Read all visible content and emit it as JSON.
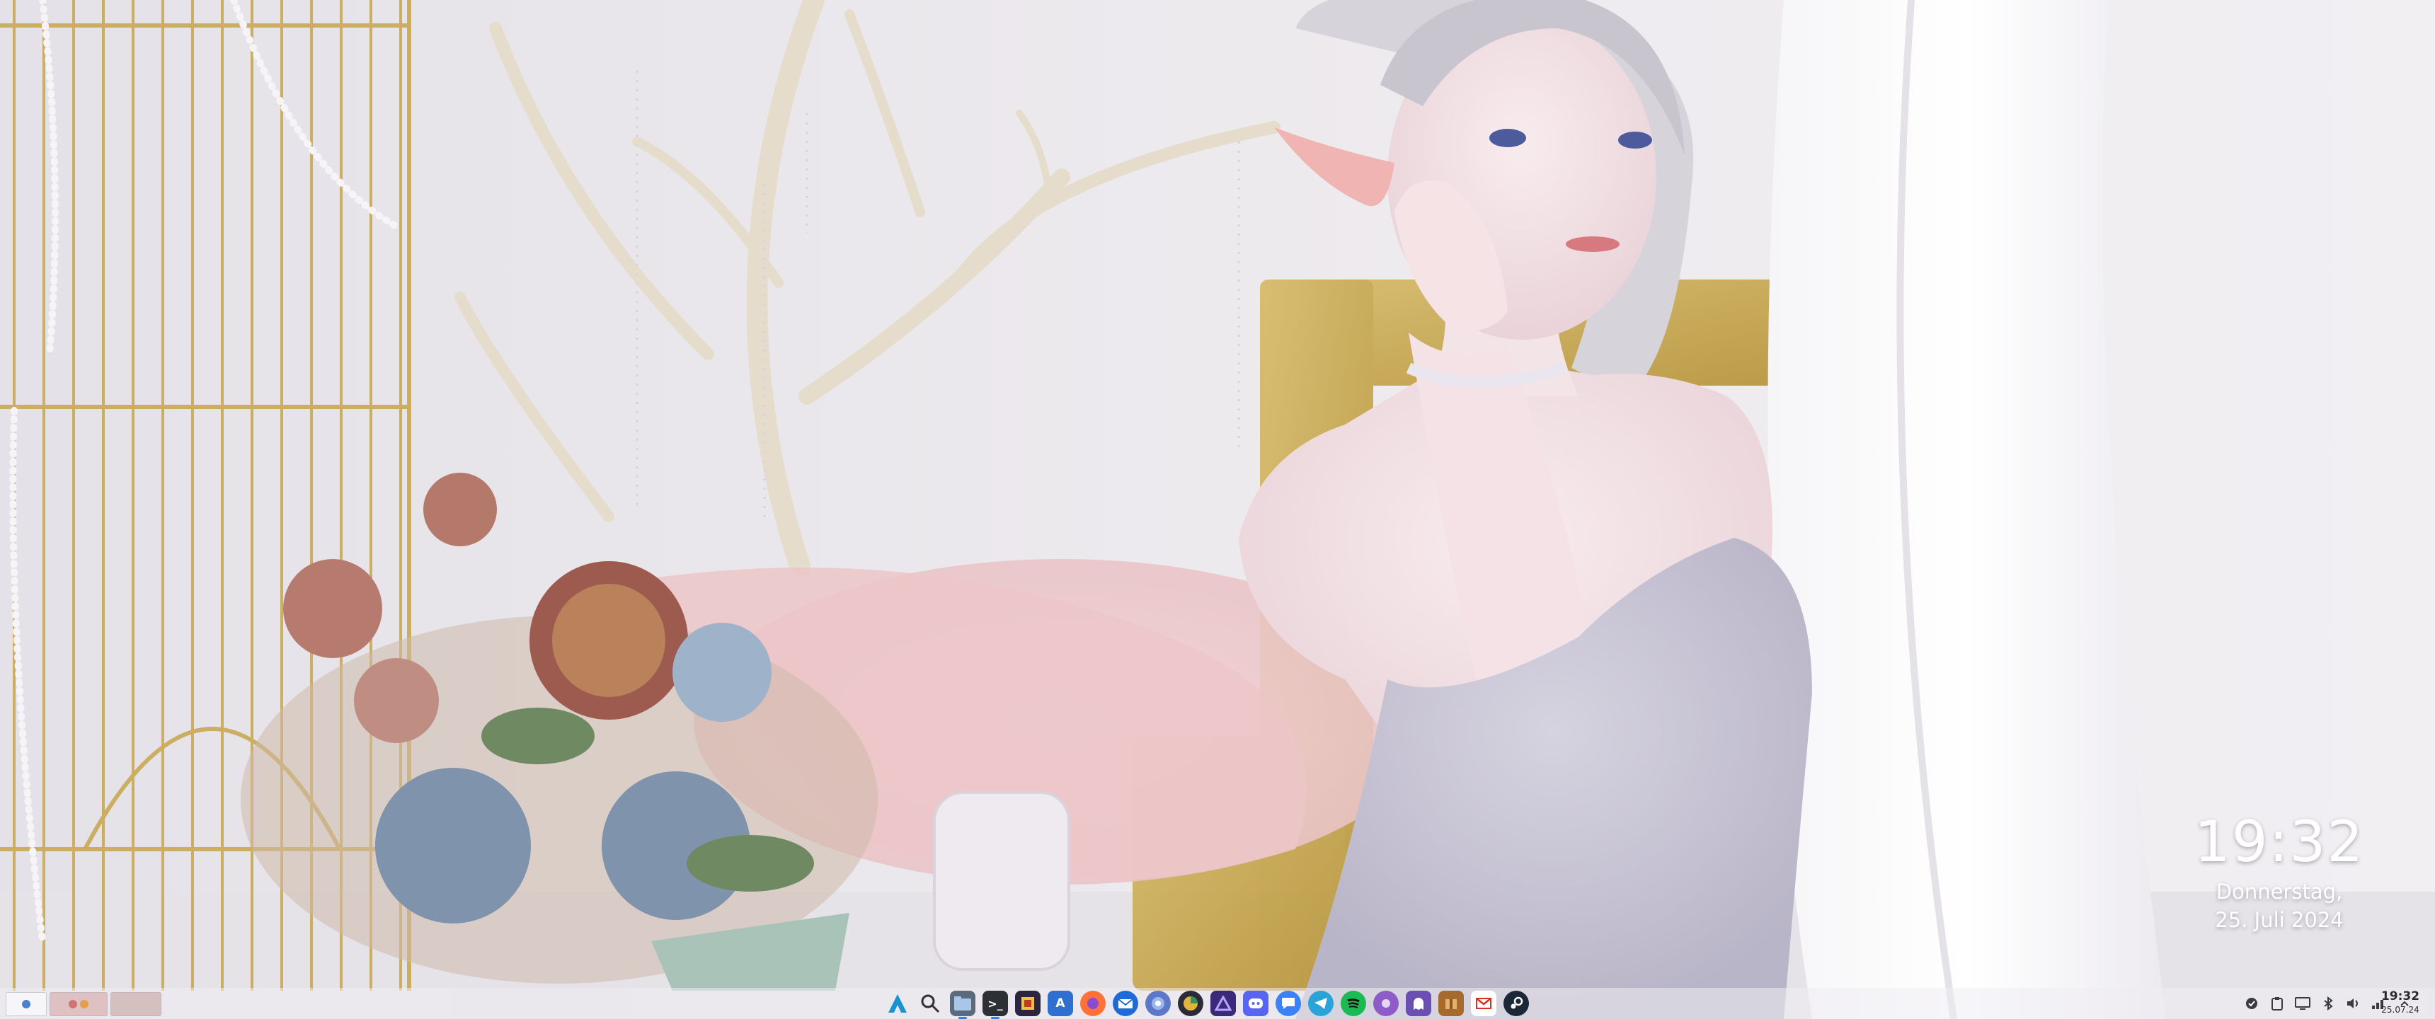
{
  "desktop": {
    "clock_widget": {
      "time": "19:32",
      "date_line1": "Donnerstag,",
      "date_line2": "25. Juli 2024"
    }
  },
  "panel": {
    "pager": {
      "desktops": [
        "desktop-1",
        "desktop-2"
      ]
    },
    "launcher_icon": "application-launcher-icon",
    "taskbar_icons": [
      "search-icon",
      "file-manager-icon",
      "terminal-icon",
      "code-editor-icon",
      "dictionary-icon",
      "firefox-icon",
      "thunderbird-icon",
      "browser-icon",
      "web-browser-icon",
      "proton-vpn-icon",
      "discord-icon",
      "chat-icon",
      "telegram-icon",
      "spotify-icon",
      "audio-app-icon",
      "ghost-icon",
      "package-icon",
      "mail-icon",
      "steam-icon"
    ],
    "tray_icons": [
      "updates-icon",
      "clipboard-icon",
      "display-icon",
      "bluetooth-icon",
      "volume-icon",
      "network-icon",
      "expand-tray-icon"
    ],
    "clock": {
      "time": "19:32",
      "date": "25.07.24"
    }
  },
  "colors": {
    "panel_bg": "#eeecf2",
    "accent": "#3d7fe0"
  }
}
